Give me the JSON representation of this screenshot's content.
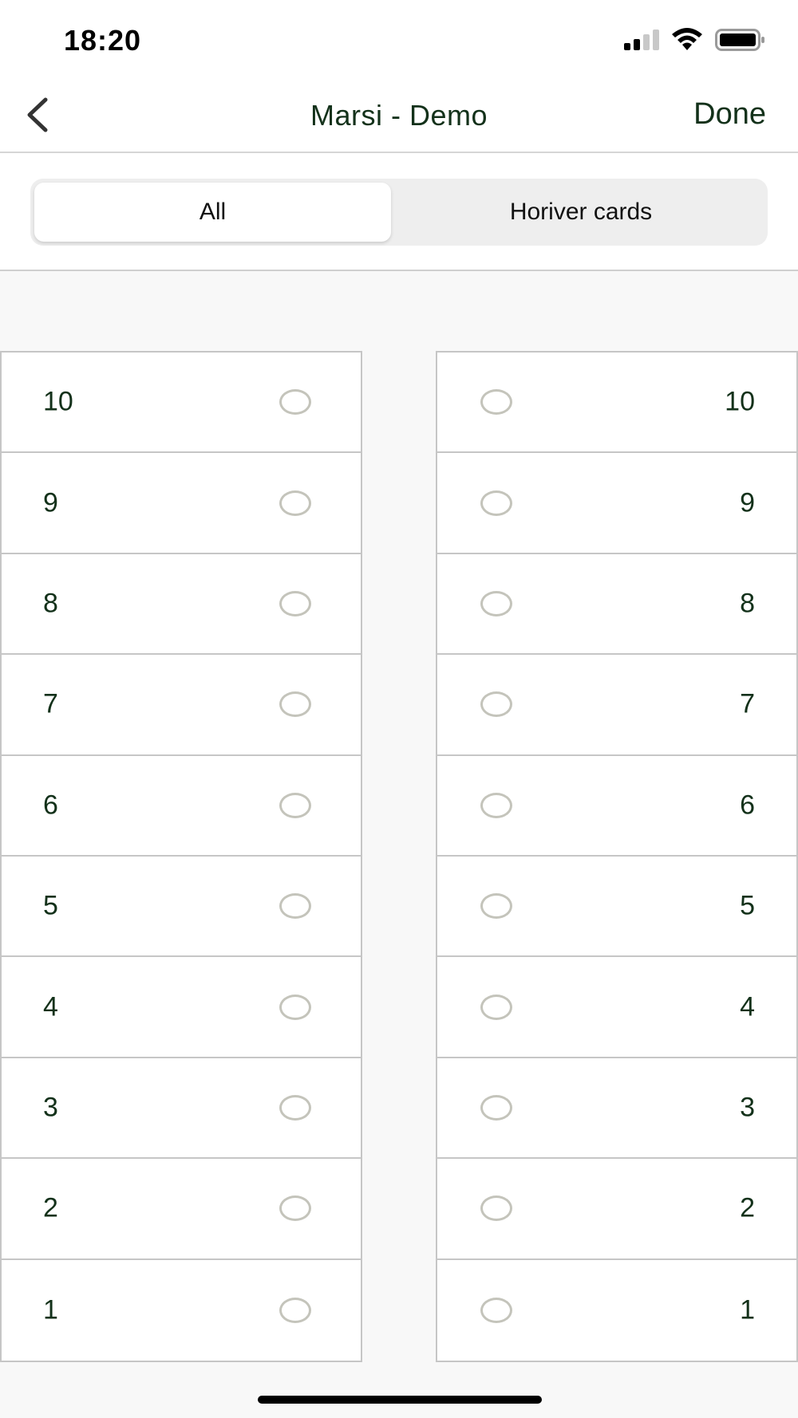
{
  "status_bar": {
    "time": "18:20",
    "icons": [
      "signal-icon",
      "wifi-icon",
      "battery-icon"
    ]
  },
  "nav": {
    "back_icon": "chevron-left-icon",
    "title": "Marsi - Demo",
    "done_label": "Done"
  },
  "segments": {
    "all_label": "All",
    "horiver_label": "Horiver cards",
    "selected": "All"
  },
  "left_column": {
    "items": [
      "10",
      "9",
      "8",
      "7",
      "6",
      "5",
      "4",
      "3",
      "2",
      "1"
    ]
  },
  "right_column": {
    "items": [
      "10",
      "9",
      "8",
      "7",
      "6",
      "5",
      "4",
      "3",
      "2",
      "1"
    ]
  },
  "colors": {
    "text_dark_green": "#13311a",
    "radio_border": "#c4c4bb",
    "divider": "#c6c6c6",
    "background": "#f8f8f8"
  }
}
